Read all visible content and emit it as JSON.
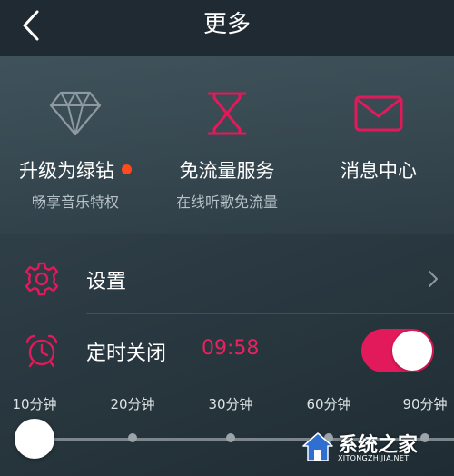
{
  "header": {
    "title": "更多",
    "back_icon": "chevron-left-icon"
  },
  "features": [
    {
      "title": "升级为绿钻",
      "subtitle": "畅享音乐特权",
      "icon": "diamond-icon",
      "badge": "red-dot"
    },
    {
      "title": "免流量服务",
      "subtitle": "在线听歌免流量",
      "icon": "hourglass-icon"
    },
    {
      "title": "消息中心",
      "subtitle": "",
      "icon": "envelope-icon"
    }
  ],
  "settings_row": {
    "label": "设置",
    "icon": "gear-icon"
  },
  "timer_row": {
    "label": "定时关闭",
    "value": "09:58",
    "icon": "alarm-clock-icon",
    "enabled": true
  },
  "slider": {
    "ticks": [
      "10分钟",
      "20分钟",
      "30分钟",
      "60分钟",
      "90分钟"
    ],
    "selected_index": 0
  },
  "watermark": {
    "text": "系统之家",
    "url": "XITONGZHIJIA.NET"
  },
  "colors": {
    "accent": "#e2195a",
    "header_bg": "#1f2a32",
    "badge": "#ff4a1e"
  }
}
